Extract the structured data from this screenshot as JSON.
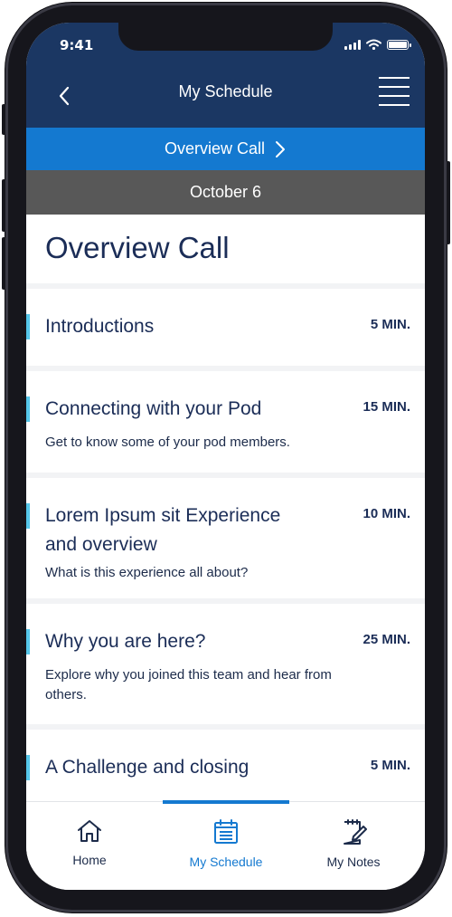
{
  "status": {
    "time": "9:41"
  },
  "header": {
    "title": "My Schedule"
  },
  "session_bar": {
    "label": "Overview Call"
  },
  "date_bar": {
    "label": "October 6"
  },
  "page": {
    "title": "Overview Call"
  },
  "agenda": [
    {
      "title": "Introductions",
      "duration": "5 MIN.",
      "description": ""
    },
    {
      "title": "Connecting with your Pod",
      "duration": "15 MIN.",
      "description": "Get to know some of your pod members."
    },
    {
      "title": "Lorem Ipsum sit Experience and overview",
      "duration": "10 MIN.",
      "description": "What is this experience all about?"
    },
    {
      "title": "Why you are here?",
      "duration": "25 MIN.",
      "description": "Explore why you joined this team and hear from others."
    },
    {
      "title": "A Challenge and closing",
      "duration": "5 MIN.",
      "description": ""
    }
  ],
  "tabs": [
    {
      "label": "Home",
      "icon": "home-icon",
      "active": false
    },
    {
      "label": "My Schedule",
      "icon": "calendar-icon",
      "active": true
    },
    {
      "label": "My Notes",
      "icon": "notes-icon",
      "active": false
    }
  ],
  "colors": {
    "navy": "#1b3763",
    "blue": "#1479d0",
    "gray_bar": "#585858",
    "accent": "#56c7ea",
    "text_dark": "#1b2d57"
  }
}
